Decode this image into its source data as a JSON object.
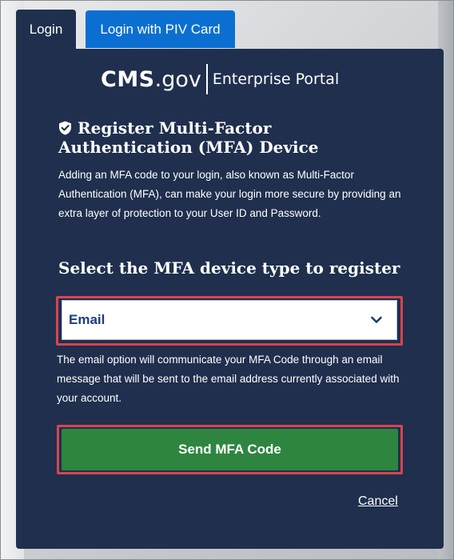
{
  "tabs": [
    {
      "label": "Login",
      "active": true
    },
    {
      "label": "Login with PIV Card",
      "active": false
    }
  ],
  "logo": {
    "cms": "CMS",
    "gov": ".gov",
    "portal": "Enterprise Portal"
  },
  "heading": {
    "line1": "Register Multi-Factor",
    "line2": "Authentication (MFA) Device",
    "icon": "shield-check-icon"
  },
  "intro_text": "Adding an MFA code to your login, also known as Multi-Factor Authentication (MFA), can make your login more secure by providing an extra layer of protection to your User ID and Password.",
  "select": {
    "label": "Select the MFA device type to register",
    "value": "Email",
    "icon": "chevron-down-icon"
  },
  "email_description": "The email option will communicate your MFA Code through an email message that will be sent to the email address currently associated with your account.",
  "buttons": {
    "send": "Send MFA Code",
    "cancel": "Cancel"
  },
  "colors": {
    "panel": "#1f2f4d",
    "tab_inactive": "#0a6fd1",
    "button_green": "#2e8540",
    "highlight_red": "#d9434e",
    "select_text": "#1f3d77"
  }
}
